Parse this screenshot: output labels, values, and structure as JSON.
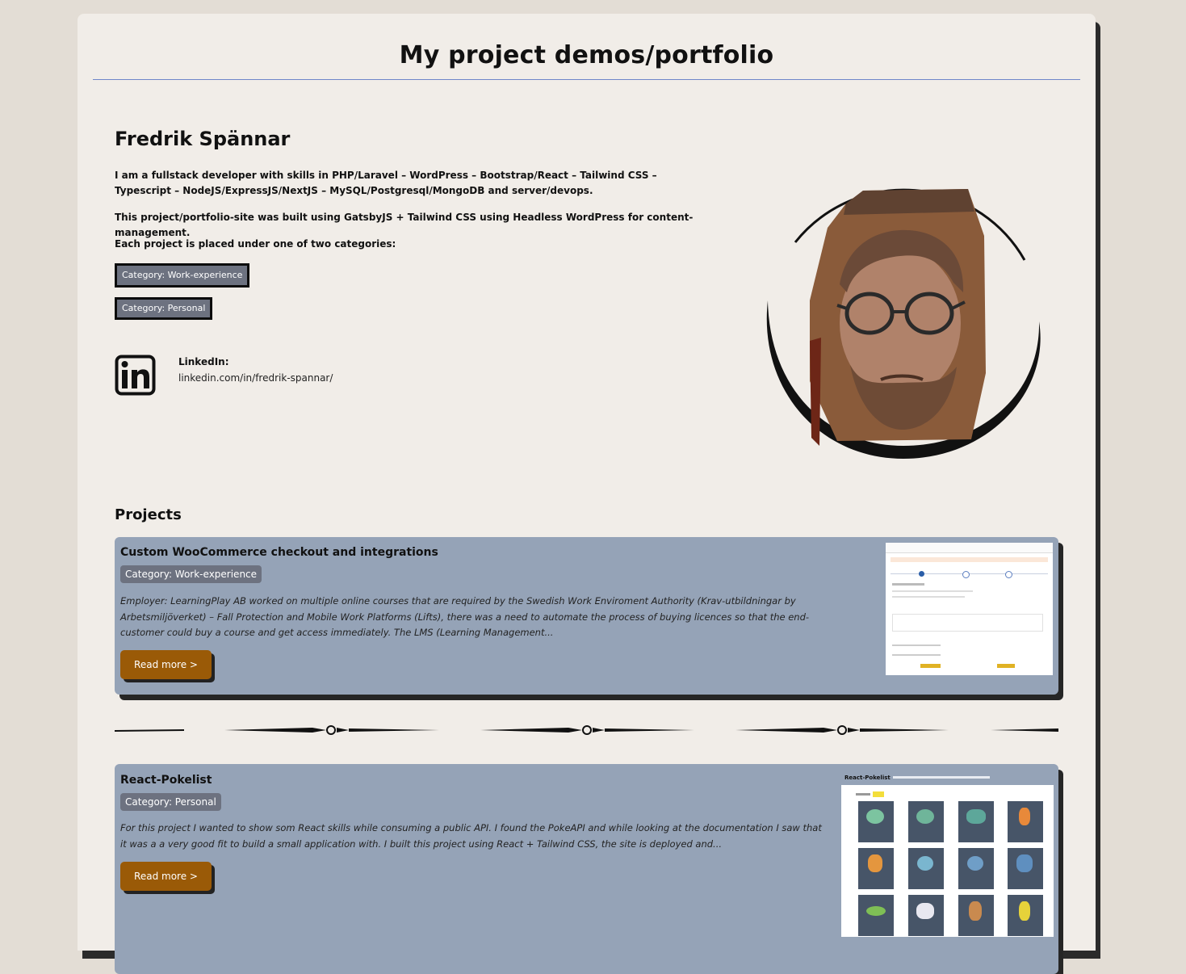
{
  "header": {
    "title": "My project demos/portfolio"
  },
  "intro": {
    "name": "Fredrik Spännar",
    "paragraph1": "I am a fullstack developer with skills in PHP/Laravel – WordPress – Bootstrap/React – Tailwind CSS – Typescript – NodeJS/ExpressJS/NextJS – MySQL/Postgresql/MongoDB and server/devops.",
    "paragraph2": "This project/portfolio-site was built using GatsbyJS + Tailwind CSS using Headless WordPress for content-management.",
    "paragraph3": "Each project is placed under one of two categories:",
    "category_work": "Category: Work-experience",
    "category_personal": "Category: Personal"
  },
  "linkedin": {
    "icon": "linkedin-icon",
    "label": "LinkedIn:",
    "url_text": "linkedin.com/in/fredrik-spannar/"
  },
  "projects": {
    "heading": "Projects",
    "items": [
      {
        "title": "Custom WooCommerce checkout and integrations",
        "category": "Category: Work-experience",
        "description": "Employer: LearningPlay AB worked on multiple online courses that are required by the Swedish Work Enviroment Authority (Krav-utbildningar by Arbetsmiljöverket) – Fall Protection and Mobile Work Platforms (Lifts), there was a need to automate the process of buying licences so that the end-customer could buy a course and get access immediately. The LMS (Learning Management...",
        "read_more": "Read more >"
      },
      {
        "title": "React-Pokelist",
        "category": "Category: Personal",
        "description": "For this project I wanted to show som React skills while consuming a public API. I found the PokeAPI and while looking at the documentation I saw that it was a a very good fit to build a small application with. I built this project using React + Tailwind CSS, the site is deployed and...",
        "read_more": "Read more >"
      }
    ]
  },
  "thumb_pokelist": {
    "title": "React-Pokelist"
  },
  "colors": {
    "page_bg": "#e3ddd5",
    "card_bg": "#f1ede8",
    "project_bg": "#95a3b7",
    "badge_bg": "#6d7280",
    "button_bg": "#9a5a07",
    "rule": "#6f86c9"
  }
}
